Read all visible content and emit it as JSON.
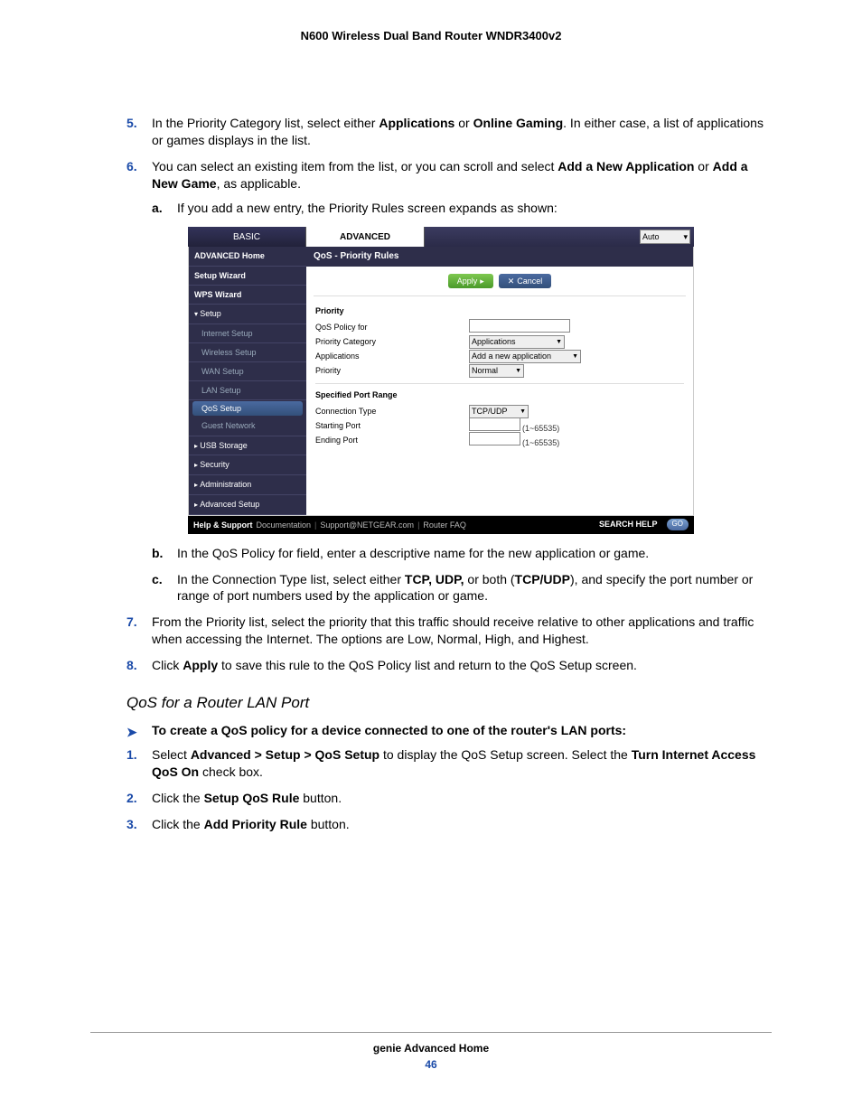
{
  "header": {
    "title": "N600 Wireless Dual Band Router WNDR3400v2"
  },
  "steps_a": [
    {
      "num": "5.",
      "pre": "In the Priority Category list, select either ",
      "b1": "Applications",
      "mid1": " or ",
      "b2": "Online Gaming",
      "post": ". In either case, a list of applications or games displays in the list."
    },
    {
      "num": "6.",
      "pre": "You can select an existing item from the list, or you can scroll and select ",
      "b1": "Add a New Application",
      "mid1": " or ",
      "b2": "Add a New Game",
      "post": ", as applicable."
    }
  ],
  "sub_a": {
    "m": "a.",
    "text": "If you add a new entry, the Priority Rules screen expands as shown:"
  },
  "screenshot": {
    "tabs": {
      "basic": "BASIC",
      "advanced": "ADVANCED",
      "auto": "Auto"
    },
    "side": {
      "adv_home": "ADVANCED Home",
      "setup_wiz": "Setup Wizard",
      "wps_wiz": "WPS Wizard",
      "setup": "Setup",
      "internet": "Internet Setup",
      "wireless": "Wireless Setup",
      "wan": "WAN Setup",
      "lan": "LAN Setup",
      "qos": "QoS Setup",
      "guest": "Guest Network",
      "usb": "USB Storage",
      "security": "Security",
      "admin": "Administration",
      "advsetup": "Advanced Setup"
    },
    "main": {
      "title": "QoS - Priority Rules",
      "apply": "Apply",
      "cancel": "Cancel",
      "priority_hdr": "Priority",
      "policy_for": "QoS Policy for",
      "category": "Priority Category",
      "category_val": "Applications",
      "applications": "Applications",
      "applications_val": "Add a new application",
      "priority_lab": "Priority",
      "priority_val": "Normal",
      "spr": "Specified Port Range",
      "conn_type": "Connection Type",
      "conn_val": "TCP/UDP",
      "start_port": "Starting Port",
      "end_port": "Ending Port",
      "range_hint": "(1~65535)"
    },
    "footer": {
      "hs": "Help & Support",
      "doc": "Documentation",
      "sup": "Support@NETGEAR.com",
      "faq": "Router FAQ",
      "search": "SEARCH HELP",
      "go": "GO"
    }
  },
  "sub_b": {
    "m": "b.",
    "text": "In the QoS Policy for field, enter a descriptive name for the new application or game."
  },
  "sub_c": {
    "m": "c.",
    "pre": "In the Connection Type list, select either ",
    "b1": "TCP, UDP,",
    "mid": " or both (",
    "b2": "TCP/UDP",
    "post": "), and specify the port number or range of port numbers used by the application or game."
  },
  "step7": {
    "num": "7.",
    "text": "From the Priority list, select the priority that this traffic should receive relative to other applications and traffic when accessing the Internet. The options are Low, Normal, High, and Highest."
  },
  "step8": {
    "num": "8.",
    "pre": "Click ",
    "b1": "Apply",
    "post": " to save this rule to the QoS Policy list and return to the QoS Setup screen."
  },
  "section_sub": "QoS for a Router LAN Port",
  "proc_head": "To create a QoS policy for a device connected to one of the router's LAN ports:",
  "steps_b": {
    "s1": {
      "num": "1.",
      "pre": "Select ",
      "b1": "Advanced > Setup > QoS Setup",
      "mid": " to display the QoS Setup screen. Select the ",
      "b2": "Turn Internet Access QoS On",
      "post": " check box."
    },
    "s2": {
      "num": "2.",
      "pre": "Click the ",
      "b1": "Setup QoS Rule",
      "post": " button."
    },
    "s3": {
      "num": "3.",
      "pre": "Click the ",
      "b1": "Add Priority Rule",
      "post": " button."
    }
  },
  "footer": {
    "section": "genie Advanced Home",
    "page": "46"
  }
}
